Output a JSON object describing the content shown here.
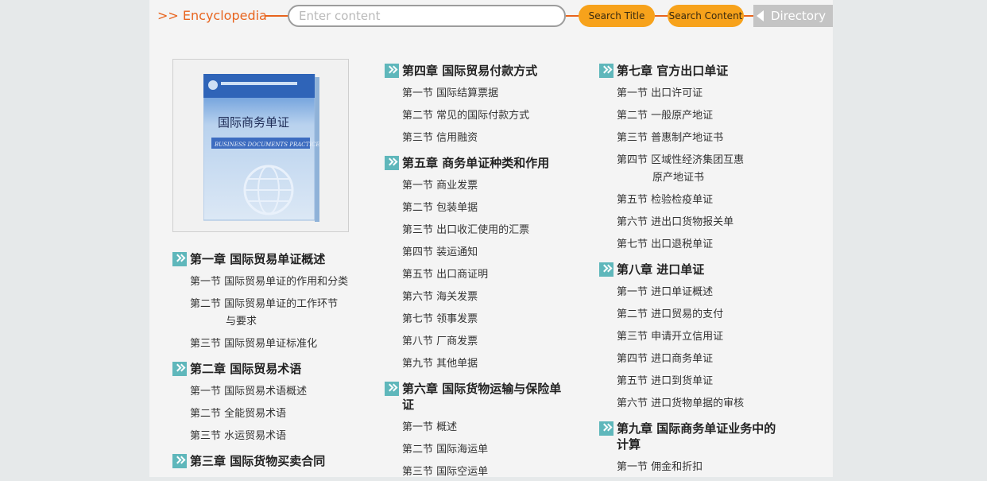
{
  "header": {
    "brand": ">> Encyclopedia",
    "search_placeholder": "Enter content",
    "search_value": "",
    "search_title_label": "Search Title",
    "search_content_label": "Search Content",
    "directory_label": "Directory"
  },
  "book": {
    "title": "国际商务单证",
    "subtitle": "BUSINESS DOCUMENTS PRACTICE"
  },
  "colors": {
    "accent": "#e8641e",
    "button": "#f7a21b",
    "chapter_icon": "#5fb7bb",
    "directory_tab": "#c4c4c4"
  },
  "toc": [
    {
      "title": "第一章 国际贸易单证概述",
      "sections": [
        "第一节 国际贸易单证的作用和分类",
        "第二节 国际贸易单证的工作环节|与要求",
        "第三节 国际贸易单证标准化"
      ]
    },
    {
      "title": "第二章 国际贸易术语",
      "sections": [
        "第一节 国际贸易术语概述",
        "第二节 全能贸易术语",
        "第三节 水运贸易术语"
      ]
    },
    {
      "title": "第三章 国际货物买卖合同",
      "sections": []
    },
    {
      "title": "第四章 国际贸易付款方式",
      "sections": [
        "第一节 国际结算票据",
        "第二节 常见的国际付款方式",
        "第三节 信用融资"
      ]
    },
    {
      "title": "第五章 商务单证种类和作用",
      "sections": [
        "第一节 商业发票",
        "第二节 包装单据",
        "第三节 出口收汇使用的汇票",
        "第四节 装运通知",
        "第五节 出口商证明",
        "第六节 海关发票",
        "第七节 领事发票",
        "第八节 厂商发票",
        "第九节 其他单据"
      ]
    },
    {
      "title": "第六章 国际货物运输与保险单|证",
      "sections": [
        "第一节 概述",
        "第二节 国际海运单",
        "第三节 国际空运单"
      ]
    },
    {
      "title": "第七章 官方出口单证",
      "sections": [
        "第一节 出口许可证",
        "第二节 一般原产地证",
        "第三节 普惠制产地证书",
        "第四节 区域性经济集团互惠|原产地证书",
        "第五节 检验检疫单证",
        "第六节 进出口货物报关单",
        "第七节 出口退税单证"
      ]
    },
    {
      "title": "第八章 进口单证",
      "sections": [
        "第一节 进口单证概述",
        "第二节 进口贸易的支付",
        "第三节 申请开立信用证",
        "第四节 进口商务单证",
        "第五节 进口到货单证",
        "第六节 进口货物单据的审核"
      ]
    },
    {
      "title": "第九章 国际商务单证业务中的|计算",
      "sections": [
        "第一节 佣金和折扣"
      ]
    }
  ]
}
